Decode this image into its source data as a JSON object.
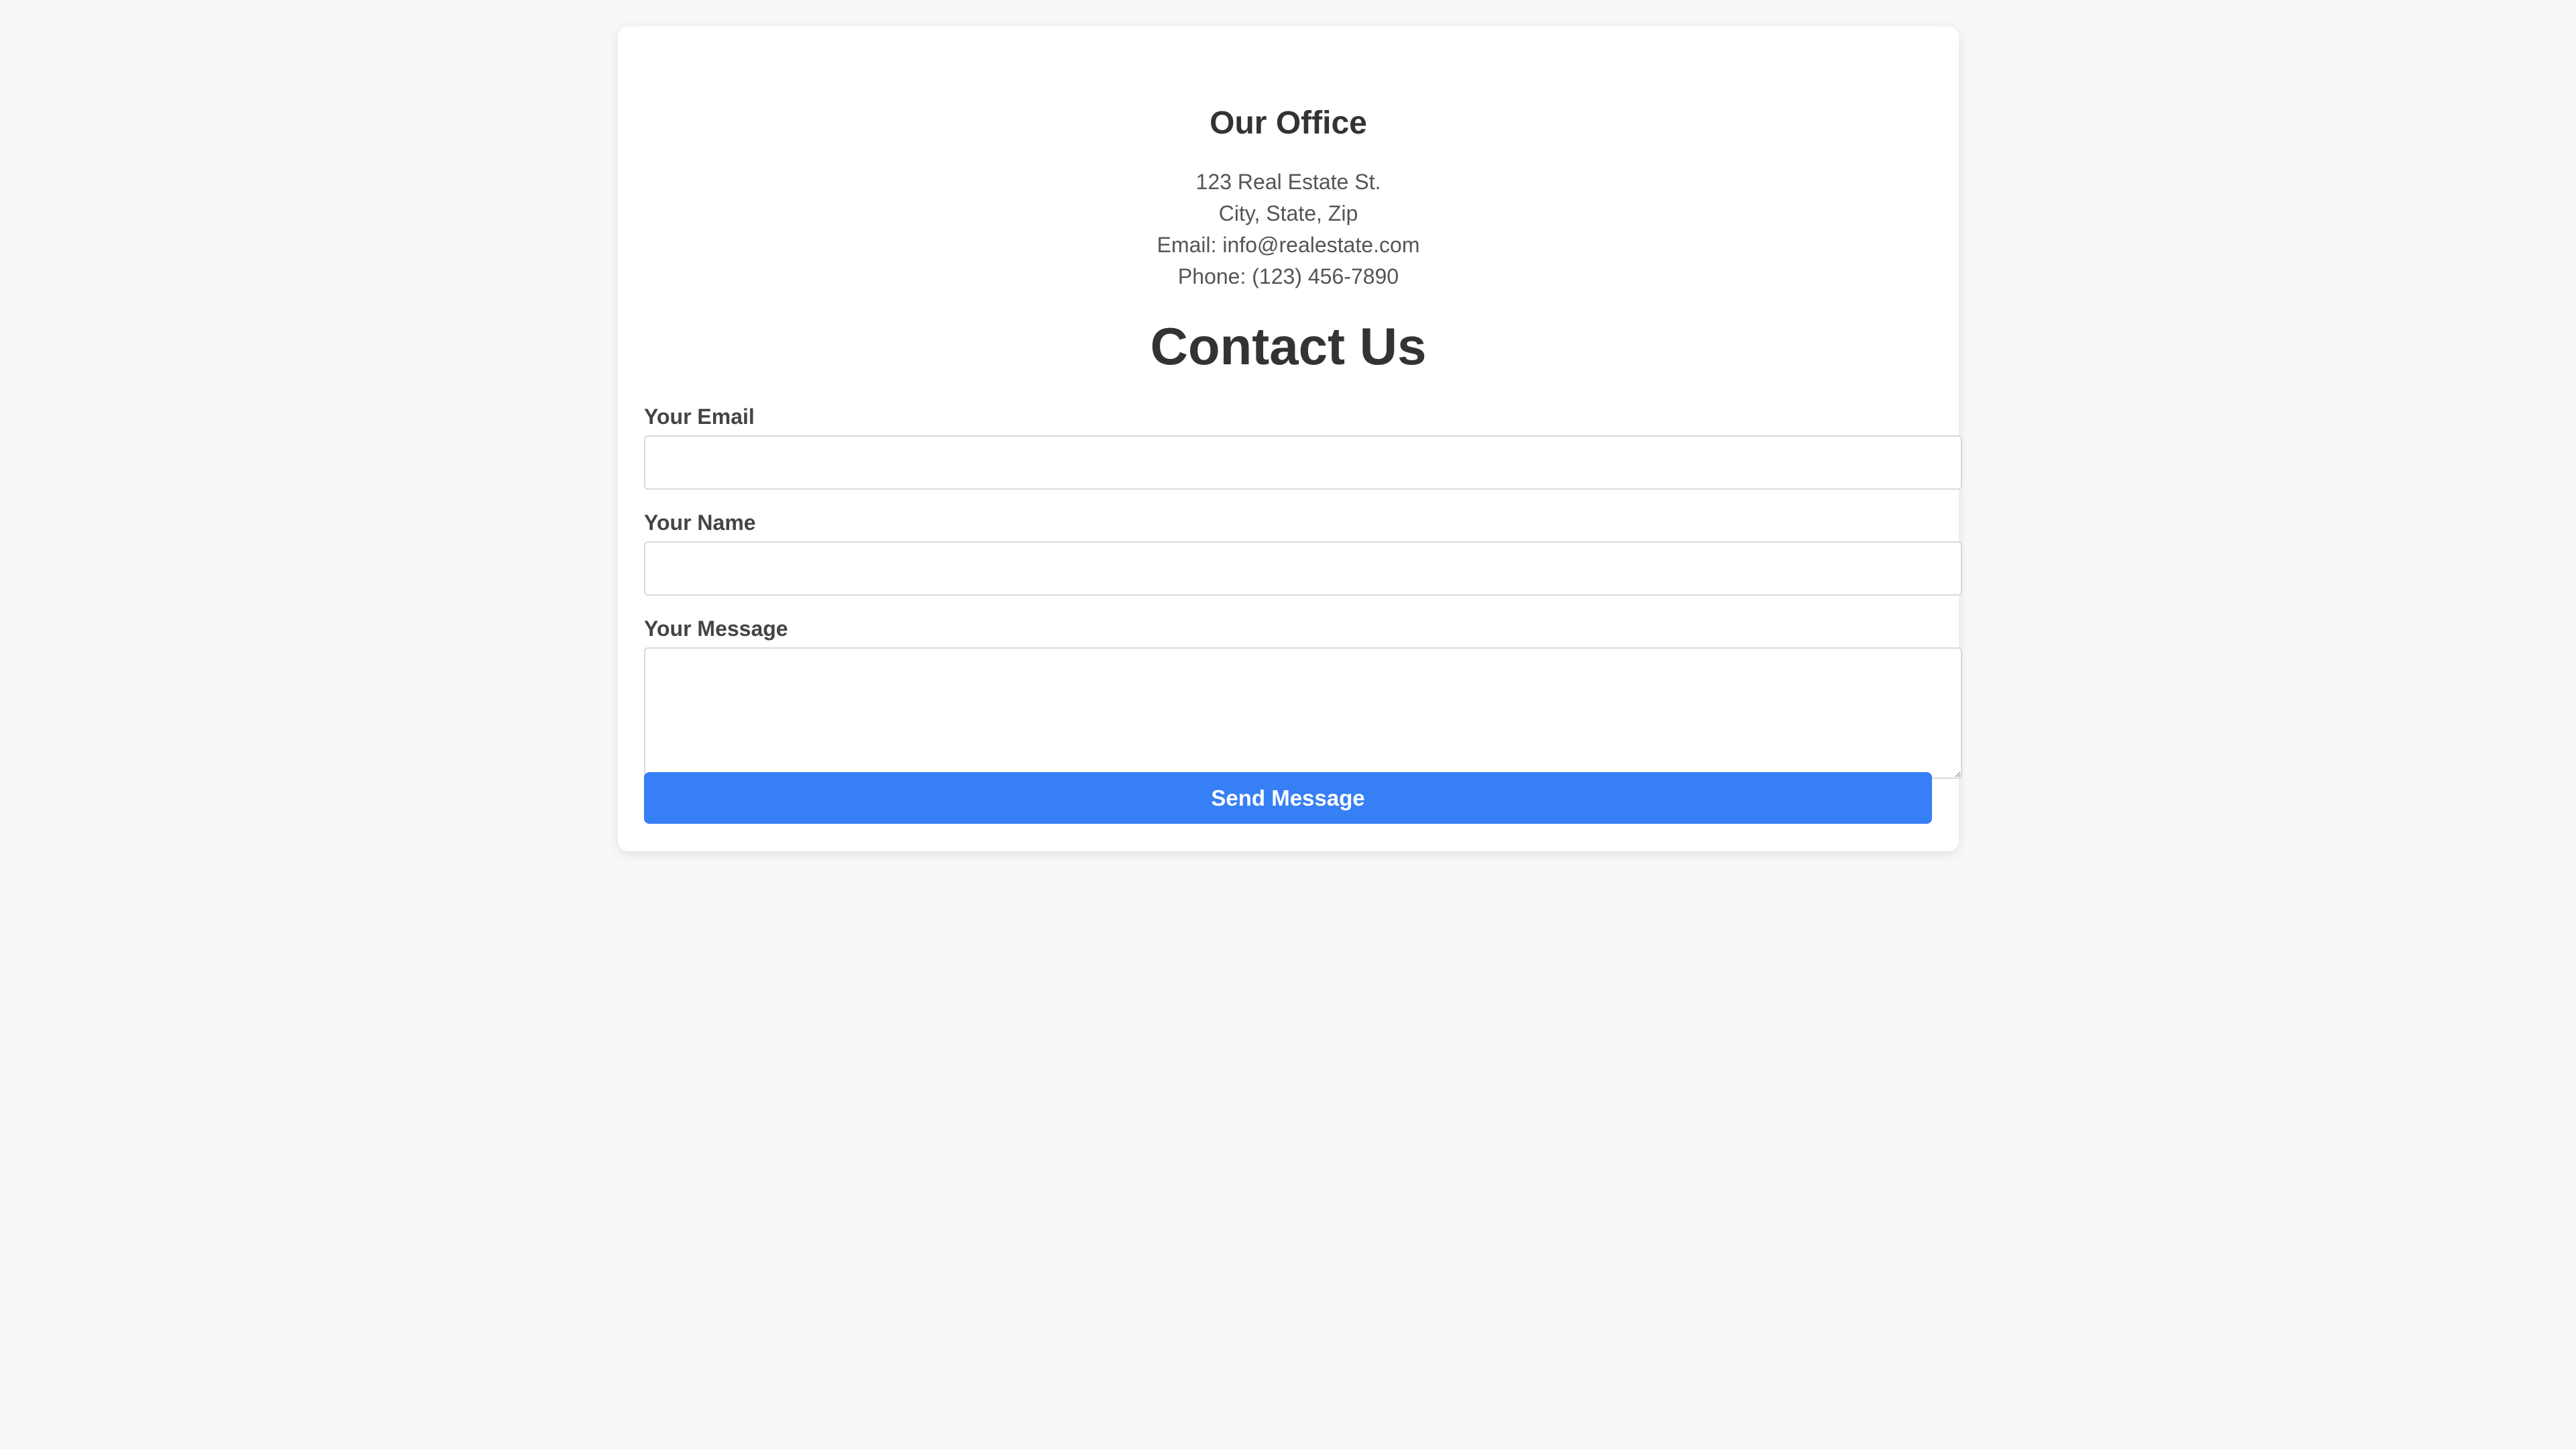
{
  "office": {
    "title": "Our Office",
    "address_line1": "123 Real Estate St.",
    "address_line2": "City, State, Zip",
    "email_line": "Email: info@realestate.com",
    "phone_line": "Phone: (123) 456-7890"
  },
  "contact": {
    "title": "Contact Us",
    "email_label": "Your Email",
    "email_value": "",
    "email_placeholder": "",
    "name_label": "Your Name",
    "name_value": "",
    "name_placeholder": "",
    "message_label": "Your Message",
    "message_value": "",
    "message_placeholder": "",
    "submit_label": "Send Message"
  },
  "colors": {
    "page_background": "#f8f8f8",
    "card_background": "#ffffff",
    "primary_button": "#377ff5",
    "heading_text": "#333333",
    "body_text": "#555555"
  }
}
